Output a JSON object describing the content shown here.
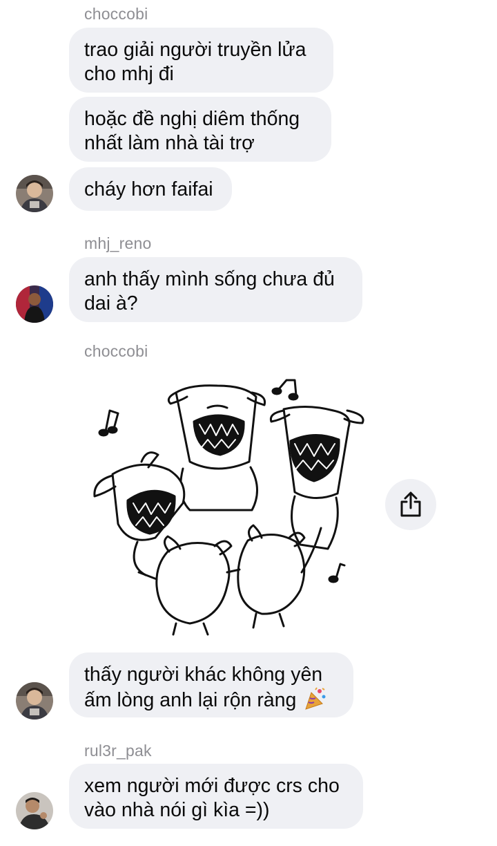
{
  "messages": [
    {
      "sender": "choccobi",
      "bubbles": [
        {
          "lines": [
            "trao giải người truyền lửa",
            "cho mhj đi"
          ]
        },
        {
          "lines": [
            "hoặc đề nghị diêm thống",
            "nhất làm nhà tài trợ"
          ]
        },
        {
          "lines": [
            "cháy hơn faifai"
          ]
        }
      ]
    },
    {
      "sender": "mhj_reno",
      "bubbles": [
        {
          "lines": [
            "anh thấy mình sống chưa đủ",
            "dai à?"
          ]
        }
      ]
    },
    {
      "sender": "choccobi",
      "bubbles": [
        {
          "lines": [
            "thấy người khác không yên",
            "ấm lòng anh lại rộn ràng"
          ]
        }
      ]
    },
    {
      "sender": "rul3r_pak",
      "bubbles": [
        {
          "lines": [
            "xem người mới được crs cho",
            "vào nhà nói gì kìa =))"
          ]
        }
      ]
    }
  ],
  "sticker": {
    "icon": "dancing-dogs-sticker"
  },
  "icons": {
    "share": "share-icon",
    "party": "party-popper-emoji"
  },
  "colors": {
    "bubble": "#eff0f4",
    "sender": "#8e8e93",
    "text": "#0a0a0a"
  }
}
